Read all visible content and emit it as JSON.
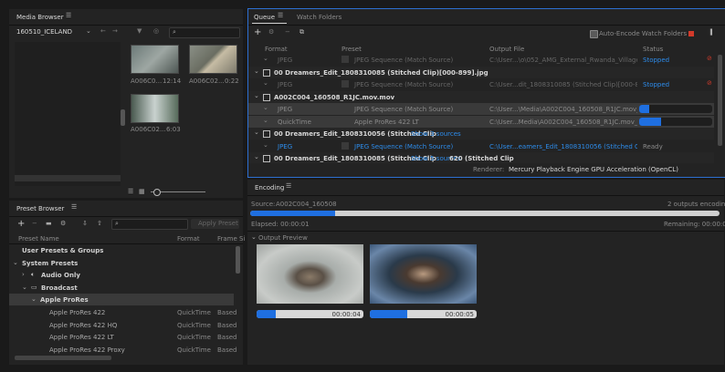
{
  "media_browser": {
    "title": "Media Browser",
    "folder": "160510_ICELAND",
    "search_placeholder": "",
    "clips": [
      {
        "name": "A006C0...",
        "duration": "12:14"
      },
      {
        "name": "A006C02...",
        "duration": "0:22"
      },
      {
        "name": "A006C02...",
        "duration": "6:03"
      }
    ]
  },
  "preset_browser": {
    "title": "Preset Browser",
    "apply_button": "Apply Preset",
    "columns": {
      "name": "Preset Name",
      "format": "Format",
      "frame": "Frame Si"
    },
    "tree": [
      {
        "label": "User Presets & Groups",
        "indent": 0,
        "format": "",
        "frame": ""
      },
      {
        "label": "System Presets",
        "indent": 0,
        "format": "",
        "frame": "",
        "caret": "⌄"
      },
      {
        "label": "Audio Only",
        "indent": 1,
        "format": "",
        "frame": "",
        "caret": "›"
      },
      {
        "label": "Broadcast",
        "indent": 1,
        "format": "",
        "frame": "",
        "caret": "⌄"
      },
      {
        "label": "Apple ProRes",
        "indent": 2,
        "format": "",
        "frame": "",
        "caret": "⌄"
      },
      {
        "label": "Apple ProRes 422",
        "indent": 3,
        "format": "QuickTime",
        "frame": "Based"
      },
      {
        "label": "Apple ProRes 422 HQ",
        "indent": 3,
        "format": "QuickTime",
        "frame": "Based"
      },
      {
        "label": "Apple ProRes 422 LT",
        "indent": 3,
        "format": "QuickTime",
        "frame": "Based"
      },
      {
        "label": "Apple ProRes 422 Proxy",
        "indent": 3,
        "format": "QuickTime",
        "frame": "Based"
      }
    ]
  },
  "queue": {
    "tab_queue": "Queue",
    "tab_watch": "Watch Folders",
    "auto_encode_label": "Auto-Encode Watch Folders",
    "columns": {
      "format": "Format",
      "preset": "Preset",
      "output": "Output File",
      "status": "Status"
    },
    "items": [
      {
        "kind": "sub",
        "format": "JPEG",
        "preset": "JPEG Sequence (Match Source)",
        "output": "C:\\User...\\o\\052_AMG_External_Rwanda_VillageT.jpg",
        "status": "Stopped",
        "stop": true
      },
      {
        "kind": "group",
        "title": "00 Dreamers_Edit_1808310085 (Stitched Clip)[000-899].jpg"
      },
      {
        "kind": "sub",
        "format": "JPEG",
        "preset": "JPEG Sequence (Match Source)",
        "output": "C:\\User...dit_1808310085 (Stitched Clip)[000-899].jpg",
        "status": "Stopped",
        "stop": true
      },
      {
        "kind": "group",
        "title": "A002C004_160508_R1JC.mov.mov"
      },
      {
        "kind": "active",
        "format": "JPEG",
        "preset": "JPEG Sequence (Match Source)",
        "output": "C:\\User...\\Media\\A002C004_160508_R1JC.mov_Copy...",
        "progress": 0.14
      },
      {
        "kind": "active",
        "format": "QuickTime",
        "preset": "Apple ProRes 422 LT",
        "output": "C:\\User...Media\\A002C004_160508_R1JC.mov_Encod...",
        "progress": 0.3
      },
      {
        "kind": "group",
        "title": "00 Dreamers_Edit_1808310056 (Stitched Clip",
        "link": "Show 3 sources"
      },
      {
        "kind": "sub",
        "format": "JPEG",
        "preset": "JPEG Sequence (Match Source)",
        "output": "C:\\User...eamers_Edit_1808310056 (Stitched Clip).jpg",
        "status": "Ready",
        "blue": true
      },
      {
        "kind": "group",
        "title": "00 Dreamers_Edit_1808310085 (Stitched Clip",
        "title2": "620 (Stitched Clip",
        "link": "Show 5 sources"
      }
    ],
    "renderer_label": "Renderer:",
    "renderer_value": "Mercury Playback Engine GPU Acceleration (OpenCL)"
  },
  "encoding": {
    "title": "Encoding",
    "source_label": "Source:",
    "source_value": "A002C004_160508",
    "outputs": "2 outputs encoding",
    "progress": 0.18,
    "elapsed": "Elapsed: 00:00:01",
    "remaining": "Remaining: 00:00:05",
    "preview_label": "Output Preview",
    "previews": [
      {
        "time": "00:00:04",
        "progress": 0.18
      },
      {
        "time": "00:00:05",
        "progress": 0.35
      }
    ]
  },
  "colors": {
    "accent": "#2d8ceb",
    "stop": "#d23a2a",
    "panel": "#232323"
  }
}
